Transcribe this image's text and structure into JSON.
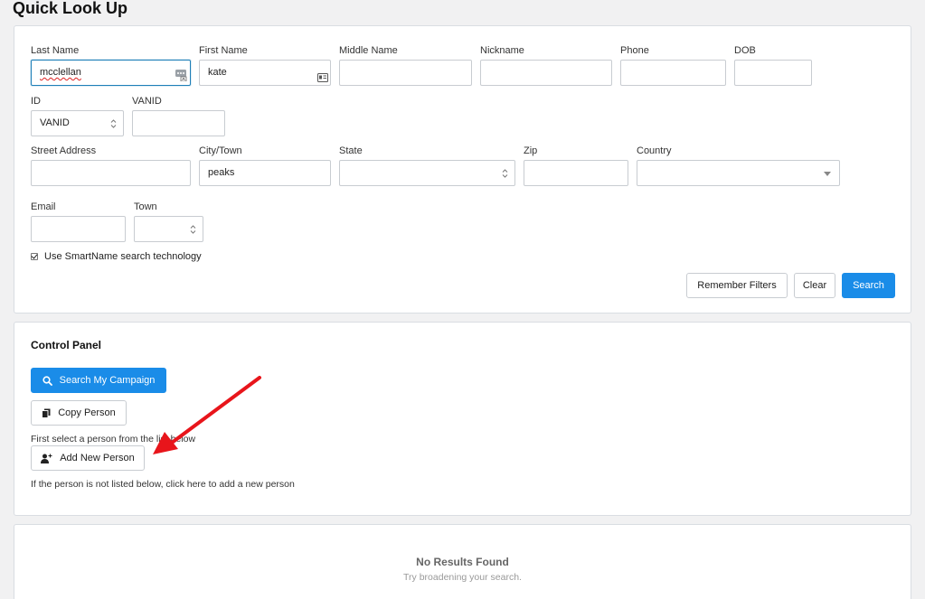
{
  "page": {
    "title": "Quick Look Up"
  },
  "filters": {
    "last_name": {
      "label": "Last Name",
      "value": "mcclellan"
    },
    "first_name": {
      "label": "First Name",
      "value": "kate"
    },
    "middle_name": {
      "label": "Middle Name",
      "value": ""
    },
    "nickname": {
      "label": "Nickname",
      "value": ""
    },
    "phone": {
      "label": "Phone",
      "value": ""
    },
    "dob": {
      "label": "DOB",
      "value": ""
    },
    "id": {
      "label": "ID",
      "value": "VANID"
    },
    "vanid": {
      "label": "VANID",
      "value": ""
    },
    "street_address": {
      "label": "Street Address",
      "value": ""
    },
    "city_town": {
      "label": "City/Town",
      "value": "peaks"
    },
    "state": {
      "label": "State",
      "value": ""
    },
    "zip": {
      "label": "Zip",
      "value": ""
    },
    "country": {
      "label": "Country",
      "value": ""
    },
    "email": {
      "label": "Email",
      "value": ""
    },
    "town": {
      "label": "Town",
      "value": ""
    },
    "smartname": {
      "label": "Use SmartName search technology",
      "checked": true
    },
    "remember_label": "Remember Filters",
    "clear_label": "Clear",
    "search_label": "Search"
  },
  "control_panel": {
    "title": "Control Panel",
    "search_campaign_label": "Search My Campaign",
    "copy_person_label": "Copy Person",
    "copy_hint": "First select a person from the list below",
    "add_person_label": "Add New Person",
    "add_hint": "If the person is not listed below, click here to add a new person"
  },
  "results": {
    "empty_title": "No Results Found",
    "empty_sub": "Try broadening your search."
  },
  "colors": {
    "primary": "#1a8ce8",
    "annotation_arrow": "#e8151b",
    "focus_border": "#1e7fb8"
  },
  "icons": [
    "contact-card-icon",
    "password-dots-icon",
    "select-arrows-icon",
    "dropdown-caret-icon",
    "search-icon",
    "copy-icon",
    "add-user-icon",
    "annotation-arrow"
  ]
}
